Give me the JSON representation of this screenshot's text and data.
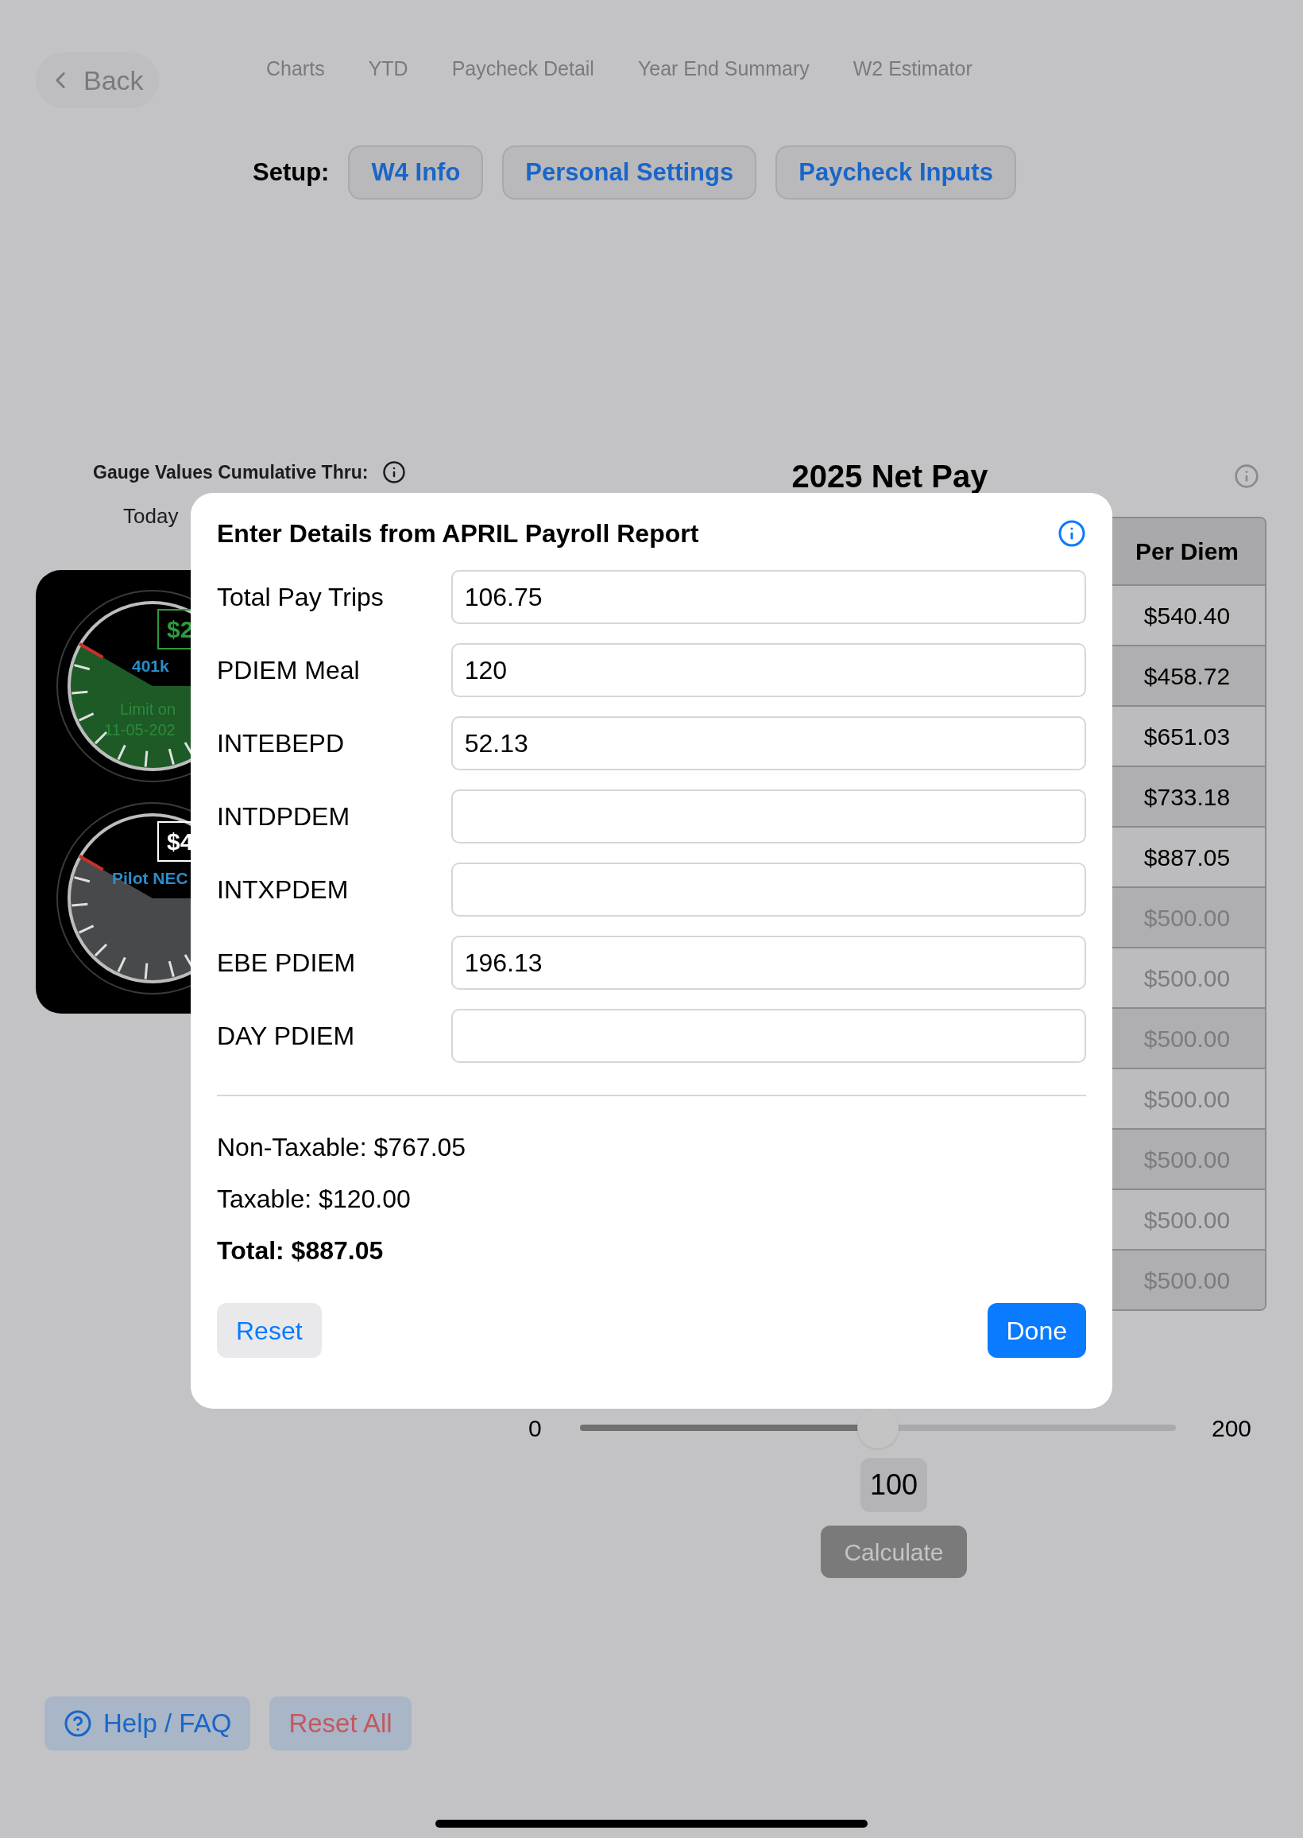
{
  "nav": {
    "back": "Back",
    "tabs": [
      "Charts",
      "YTD",
      "Paycheck Detail",
      "Year End Summary",
      "W2 Estimator"
    ]
  },
  "setup": {
    "label": "Setup:",
    "buttons": [
      "W4 Info",
      "Personal Settings",
      "Paycheck Inputs"
    ]
  },
  "gauges": {
    "label": "Gauge Values Cumulative Thru:",
    "period": "Today",
    "items": [
      {
        "value": "$2",
        "name": "401k",
        "note": [
          "Limit on",
          "11-05-202"
        ],
        "color": "#1d5a26"
      },
      {
        "value": "$4",
        "name": "Pilot NEC",
        "color": "#48494a"
      }
    ]
  },
  "net_pay": {
    "title": "2025 Net Pay",
    "columns": [
      "Per Diem"
    ],
    "rows": [
      {
        "per_diem": "$540.40",
        "estimated": false
      },
      {
        "per_diem": "$458.72",
        "estimated": false
      },
      {
        "per_diem": "$651.03",
        "estimated": false
      },
      {
        "per_diem": "$733.18",
        "estimated": false
      },
      {
        "per_diem": "$887.05",
        "estimated": false
      },
      {
        "per_diem": "$500.00",
        "estimated": true
      },
      {
        "per_diem": "$500.00",
        "estimated": true
      },
      {
        "per_diem": "$500.00",
        "estimated": true
      },
      {
        "per_diem": "$500.00",
        "estimated": true
      },
      {
        "per_diem": "$500.00",
        "estimated": true
      },
      {
        "per_diem": "$500.00",
        "estimated": true
      },
      {
        "per_diem": "$500.00",
        "estimated": true
      }
    ]
  },
  "slider": {
    "min": "0",
    "max": "200",
    "level": 0.5,
    "value": "100"
  },
  "calculate": {
    "label": "Calculate",
    "disabled": true
  },
  "footer": {
    "help": "Help / FAQ",
    "reset_all": "Reset All"
  },
  "dialog": {
    "title": "Enter Details from APRIL Payroll Report",
    "fields": [
      {
        "label": "Total Pay Trips",
        "value": "106.75"
      },
      {
        "label": "PDIEM Meal",
        "value": "120"
      },
      {
        "label": "INTEBEPD",
        "value": "52.13"
      },
      {
        "label": "INTDPDEM"
      },
      {
        "label": "INTXPDEM"
      },
      {
        "label": "EBE PDIEM",
        "value": "196.13"
      },
      {
        "label": "DAY PDIEM"
      }
    ],
    "summary": [
      "Non-Taxable: $767.05",
      "Taxable: $120.00"
    ],
    "total": "Total: $887.05",
    "reset": "Reset",
    "done": "Done"
  }
}
